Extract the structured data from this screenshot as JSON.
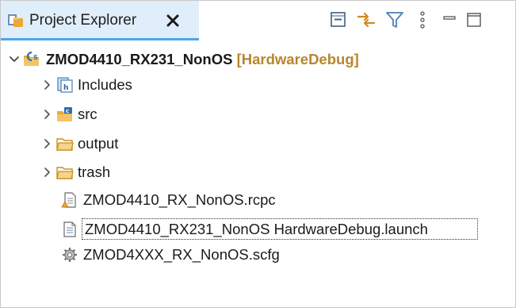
{
  "view": {
    "title": "Project Explorer",
    "close_glyph": "✕",
    "colors": {
      "tab_background": "#e0eefb",
      "tab_underline": "#4ea4e8",
      "project_decoration": "#b8862e"
    },
    "toolbar": [
      {
        "name": "collapse-all-icon"
      },
      {
        "name": "link-with-editor-icon"
      },
      {
        "name": "filter-icon"
      },
      {
        "name": "view-menu-icon"
      },
      {
        "name": "minimize-icon"
      },
      {
        "name": "maximize-icon"
      }
    ]
  },
  "tree": {
    "project": {
      "name": "ZMOD4410_RX231_NonOS",
      "decoration": "[HardwareDebug]",
      "expanded": true,
      "icon": "c-project-icon"
    },
    "children": [
      {
        "label": "Includes",
        "icon": "includes-folder-icon",
        "expandable": true,
        "expanded": false
      },
      {
        "label": "src",
        "icon": "source-folder-icon",
        "expandable": true,
        "expanded": false
      },
      {
        "label": "output",
        "icon": "folder-icon",
        "expandable": true,
        "expanded": false
      },
      {
        "label": "trash",
        "icon": "folder-icon",
        "expandable": true,
        "expanded": false
      },
      {
        "label": "ZMOD4410_RX_NonOS.rcpc",
        "icon": "rcpc-file-icon",
        "expandable": false
      },
      {
        "label": "ZMOD4410_RX231_NonOS HardwareDebug.launch",
        "icon": "launch-file-icon",
        "expandable": false,
        "focused": true
      },
      {
        "label": "ZMOD4XXX_RX_NonOS.scfg",
        "icon": "scfg-file-icon",
        "expandable": false
      }
    ]
  }
}
